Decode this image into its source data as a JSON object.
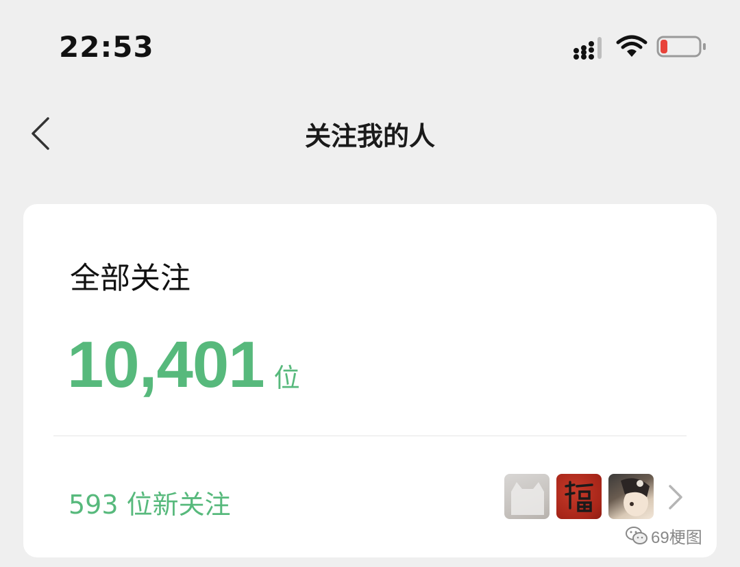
{
  "status_bar": {
    "time": "22:53",
    "battery_color": "#e8433a"
  },
  "nav": {
    "title": "关注我的人",
    "back_icon": "chevron-left-icon"
  },
  "card": {
    "section_label": "全部关注",
    "total_count": "10,401",
    "count_unit": "位",
    "new_followers_label": "593 位新关注",
    "avatars": [
      "avatar-cat",
      "avatar-fu",
      "avatar-girl"
    ],
    "accent_color": "#57b97c"
  },
  "watermark": {
    "text": "69梗图"
  }
}
